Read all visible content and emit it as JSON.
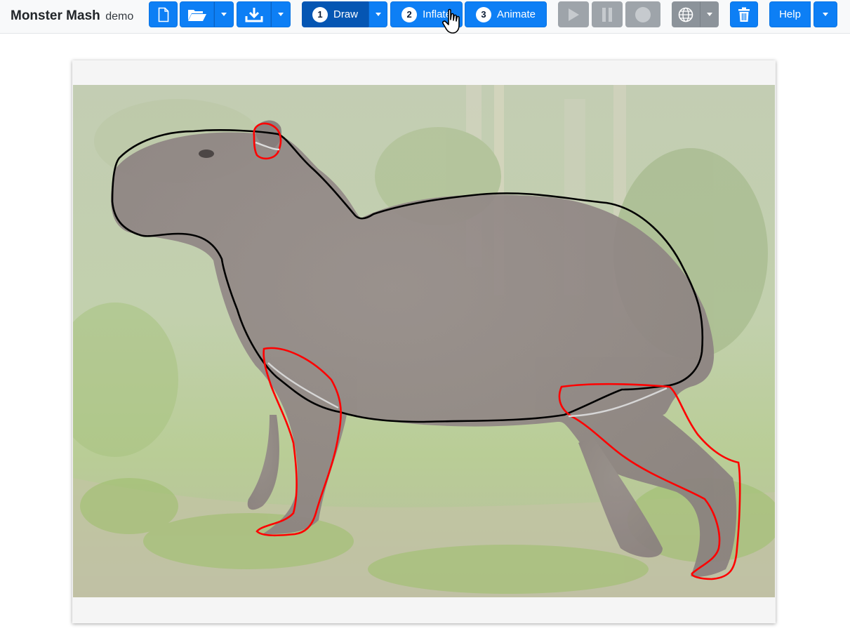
{
  "app": {
    "title": "Monster Mash",
    "subtitle": "demo"
  },
  "toolbar": {
    "new_icon": "file-icon",
    "open_icon": "folder-open-icon",
    "save_icon": "download-icon",
    "play_icon": "play-icon",
    "pause_icon": "pause-icon",
    "record_icon": "record-icon",
    "language_icon": "globe-icon",
    "clear_icon": "trash-icon",
    "help_label": "Help",
    "modes": [
      {
        "num": "1",
        "label": "Draw"
      },
      {
        "num": "2",
        "label": "Inflate"
      },
      {
        "num": "3",
        "label": "Animate"
      }
    ],
    "active_mode": "Draw"
  },
  "canvas": {
    "subject": "capybara-photo",
    "outline_color": "#000000",
    "part_color": "#ff0000",
    "correspondence_color": "#d9d9d9"
  },
  "colors": {
    "primary": "#0d7ff5",
    "active": "#0556b3",
    "disabled": "#9aa0a6"
  }
}
